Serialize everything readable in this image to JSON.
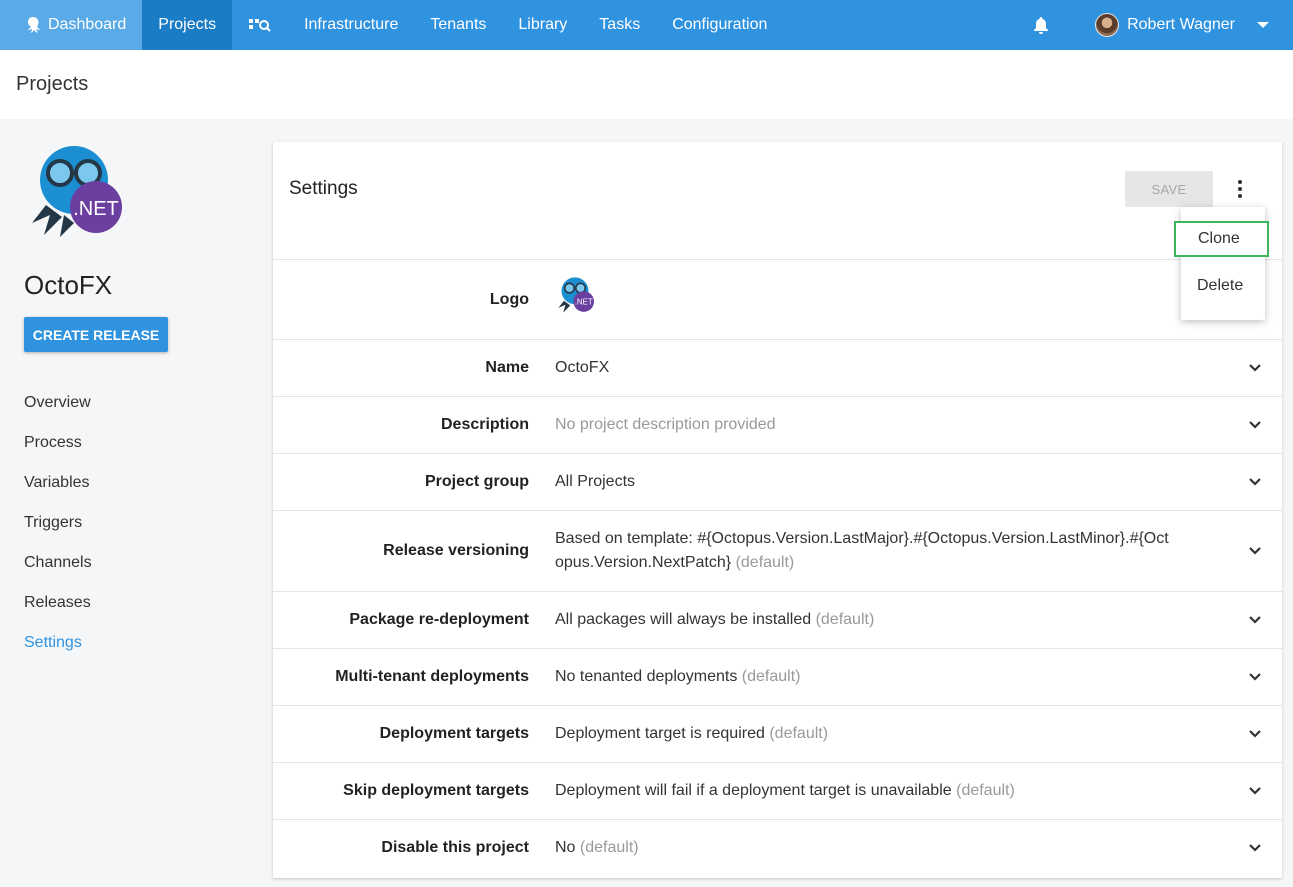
{
  "nav": {
    "items": [
      {
        "label": "Dashboard"
      },
      {
        "label": "Projects"
      },
      {
        "label": "Infrastructure"
      },
      {
        "label": "Tenants"
      },
      {
        "label": "Library"
      },
      {
        "label": "Tasks"
      },
      {
        "label": "Configuration"
      }
    ],
    "user_name": "Robert Wagner"
  },
  "breadcrumb": {
    "title": "Projects"
  },
  "sidebar": {
    "project_name": "OctoFX",
    "logo_text": ".NET",
    "create_release_label": "CREATE RELEASE",
    "items": [
      {
        "label": "Overview"
      },
      {
        "label": "Process"
      },
      {
        "label": "Variables"
      },
      {
        "label": "Triggers"
      },
      {
        "label": "Channels"
      },
      {
        "label": "Releases"
      },
      {
        "label": "Settings",
        "active": true
      }
    ]
  },
  "settings": {
    "title": "Settings",
    "save_label": "SAVE",
    "menu": {
      "clone_label": "Clone",
      "delete_label": "Delete"
    },
    "logo_label": "Logo",
    "rows": [
      {
        "label": "Name",
        "value": "OctoFX",
        "suffix": ""
      },
      {
        "label": "Description",
        "value": "",
        "suffix": "No project description provided"
      },
      {
        "label": "Project group",
        "value": "All Projects",
        "suffix": ""
      },
      {
        "label": "Release versioning",
        "value": "Based on template: #{Octopus.Version.LastMajor}.#{Octopus.Version.LastMinor}.#{Octopus.Version.NextPatch}",
        "suffix": "(default)"
      },
      {
        "label": "Package re-deployment",
        "value": "All packages will always be installed",
        "suffix": "(default)"
      },
      {
        "label": "Multi-tenant deployments",
        "value": "No tenanted deployments",
        "suffix": "(default)"
      },
      {
        "label": "Deployment targets",
        "value": "Deployment target is required",
        "suffix": "(default)"
      },
      {
        "label": "Skip deployment targets",
        "value": "Deployment will fail if a deployment target is unavailable",
        "suffix": "(default)"
      },
      {
        "label": "Disable this project",
        "value": "No",
        "suffix": "(default)"
      }
    ]
  },
  "colors": {
    "nav_bg": "#2f93e0",
    "accent": "#2f93e0",
    "highlight": "#3cb55b"
  }
}
